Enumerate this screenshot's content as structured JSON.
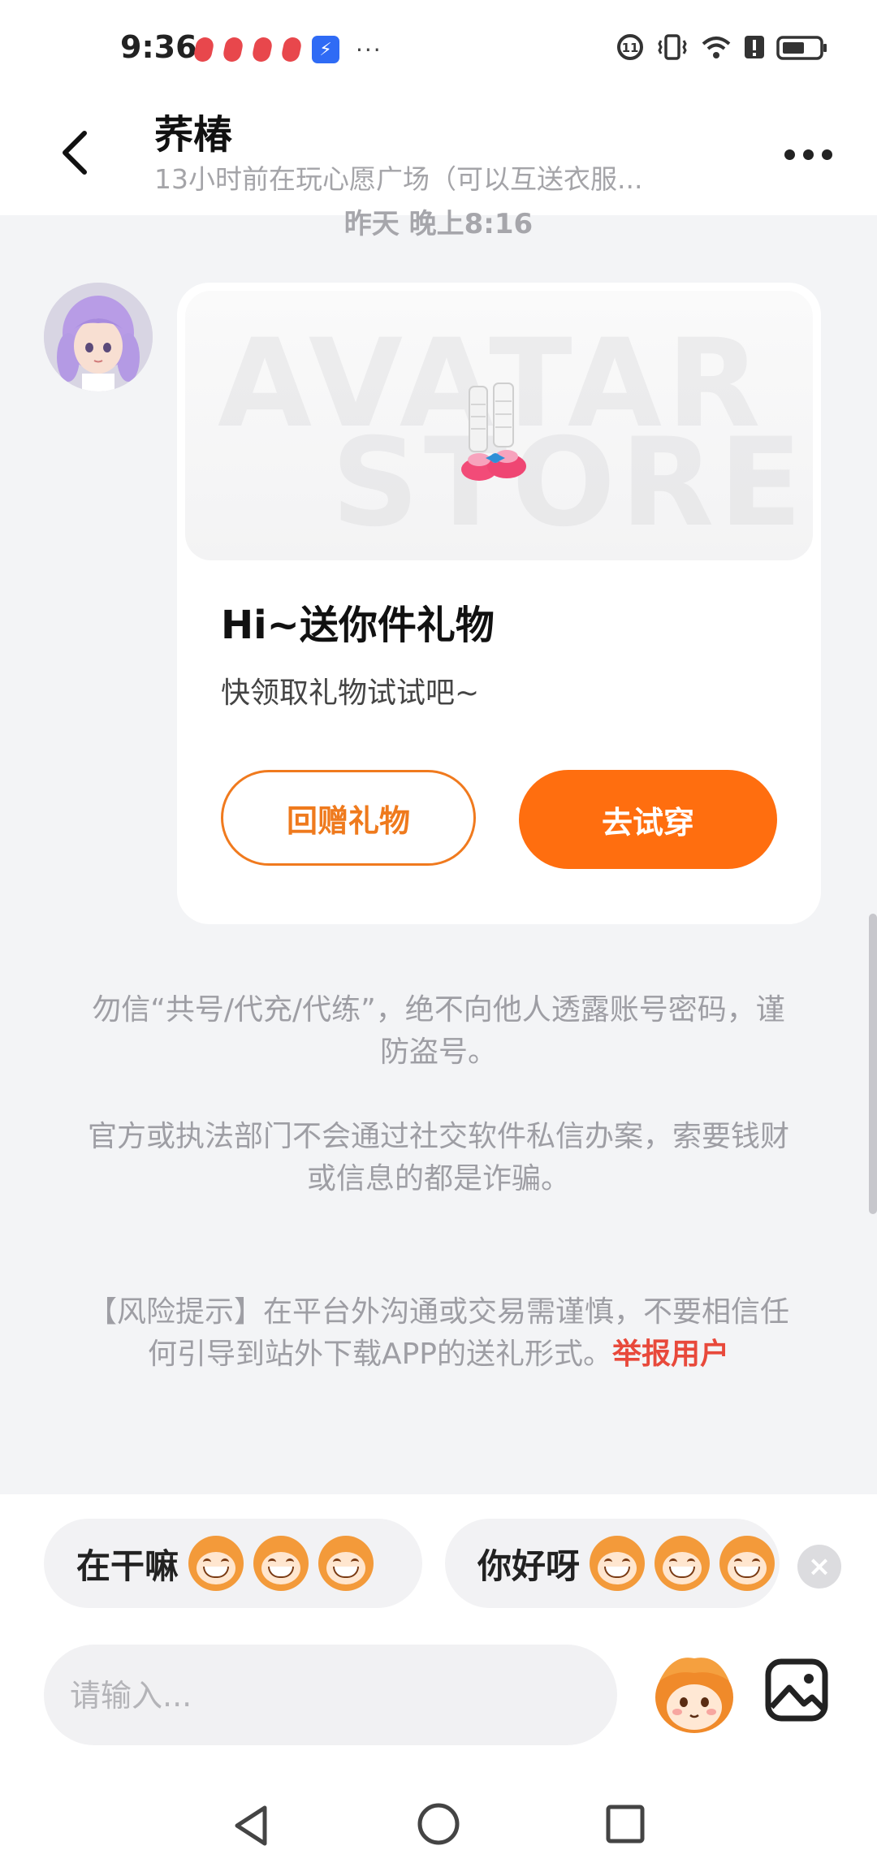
{
  "status_bar": {
    "time": "9:36",
    "more": "···"
  },
  "header": {
    "back_icon": "chevron-left-icon",
    "title": "荞椿",
    "subtitle": "13小时前在玩心愿广场（可以互送衣服...",
    "more_icon": "more-dots-icon"
  },
  "timestamp": "昨天 晚上8:16",
  "gift_card": {
    "watermark_line1": "AVATAR",
    "watermark_line2": "STORE",
    "title": "Hi~送你件礼物",
    "subtitle": "快领取礼物试试吧~",
    "return_gift_label": "回赠礼物",
    "try_on_label": "去试穿"
  },
  "notices": {
    "security_1": "勿信“共号/代充/代练”，绝不向他人透露账号密码，谨防盗号。",
    "security_2": "官方或执法部门不会通过社交软件私信办案，索要钱财或信息的都是诈骗。",
    "risk_text": "【风险提示】在平台外沟通或交易需谨慎，不要相信任何引导到站外下载APP的送礼形式。",
    "report_link": "举报用户"
  },
  "quick_replies": [
    {
      "text": "在干嘛"
    },
    {
      "text": "你好呀"
    }
  ],
  "input": {
    "placeholder": "请输入..."
  },
  "colors": {
    "accent": "#ff6e0f",
    "report": "#e8493b",
    "notice_text": "#9e9ea4"
  }
}
